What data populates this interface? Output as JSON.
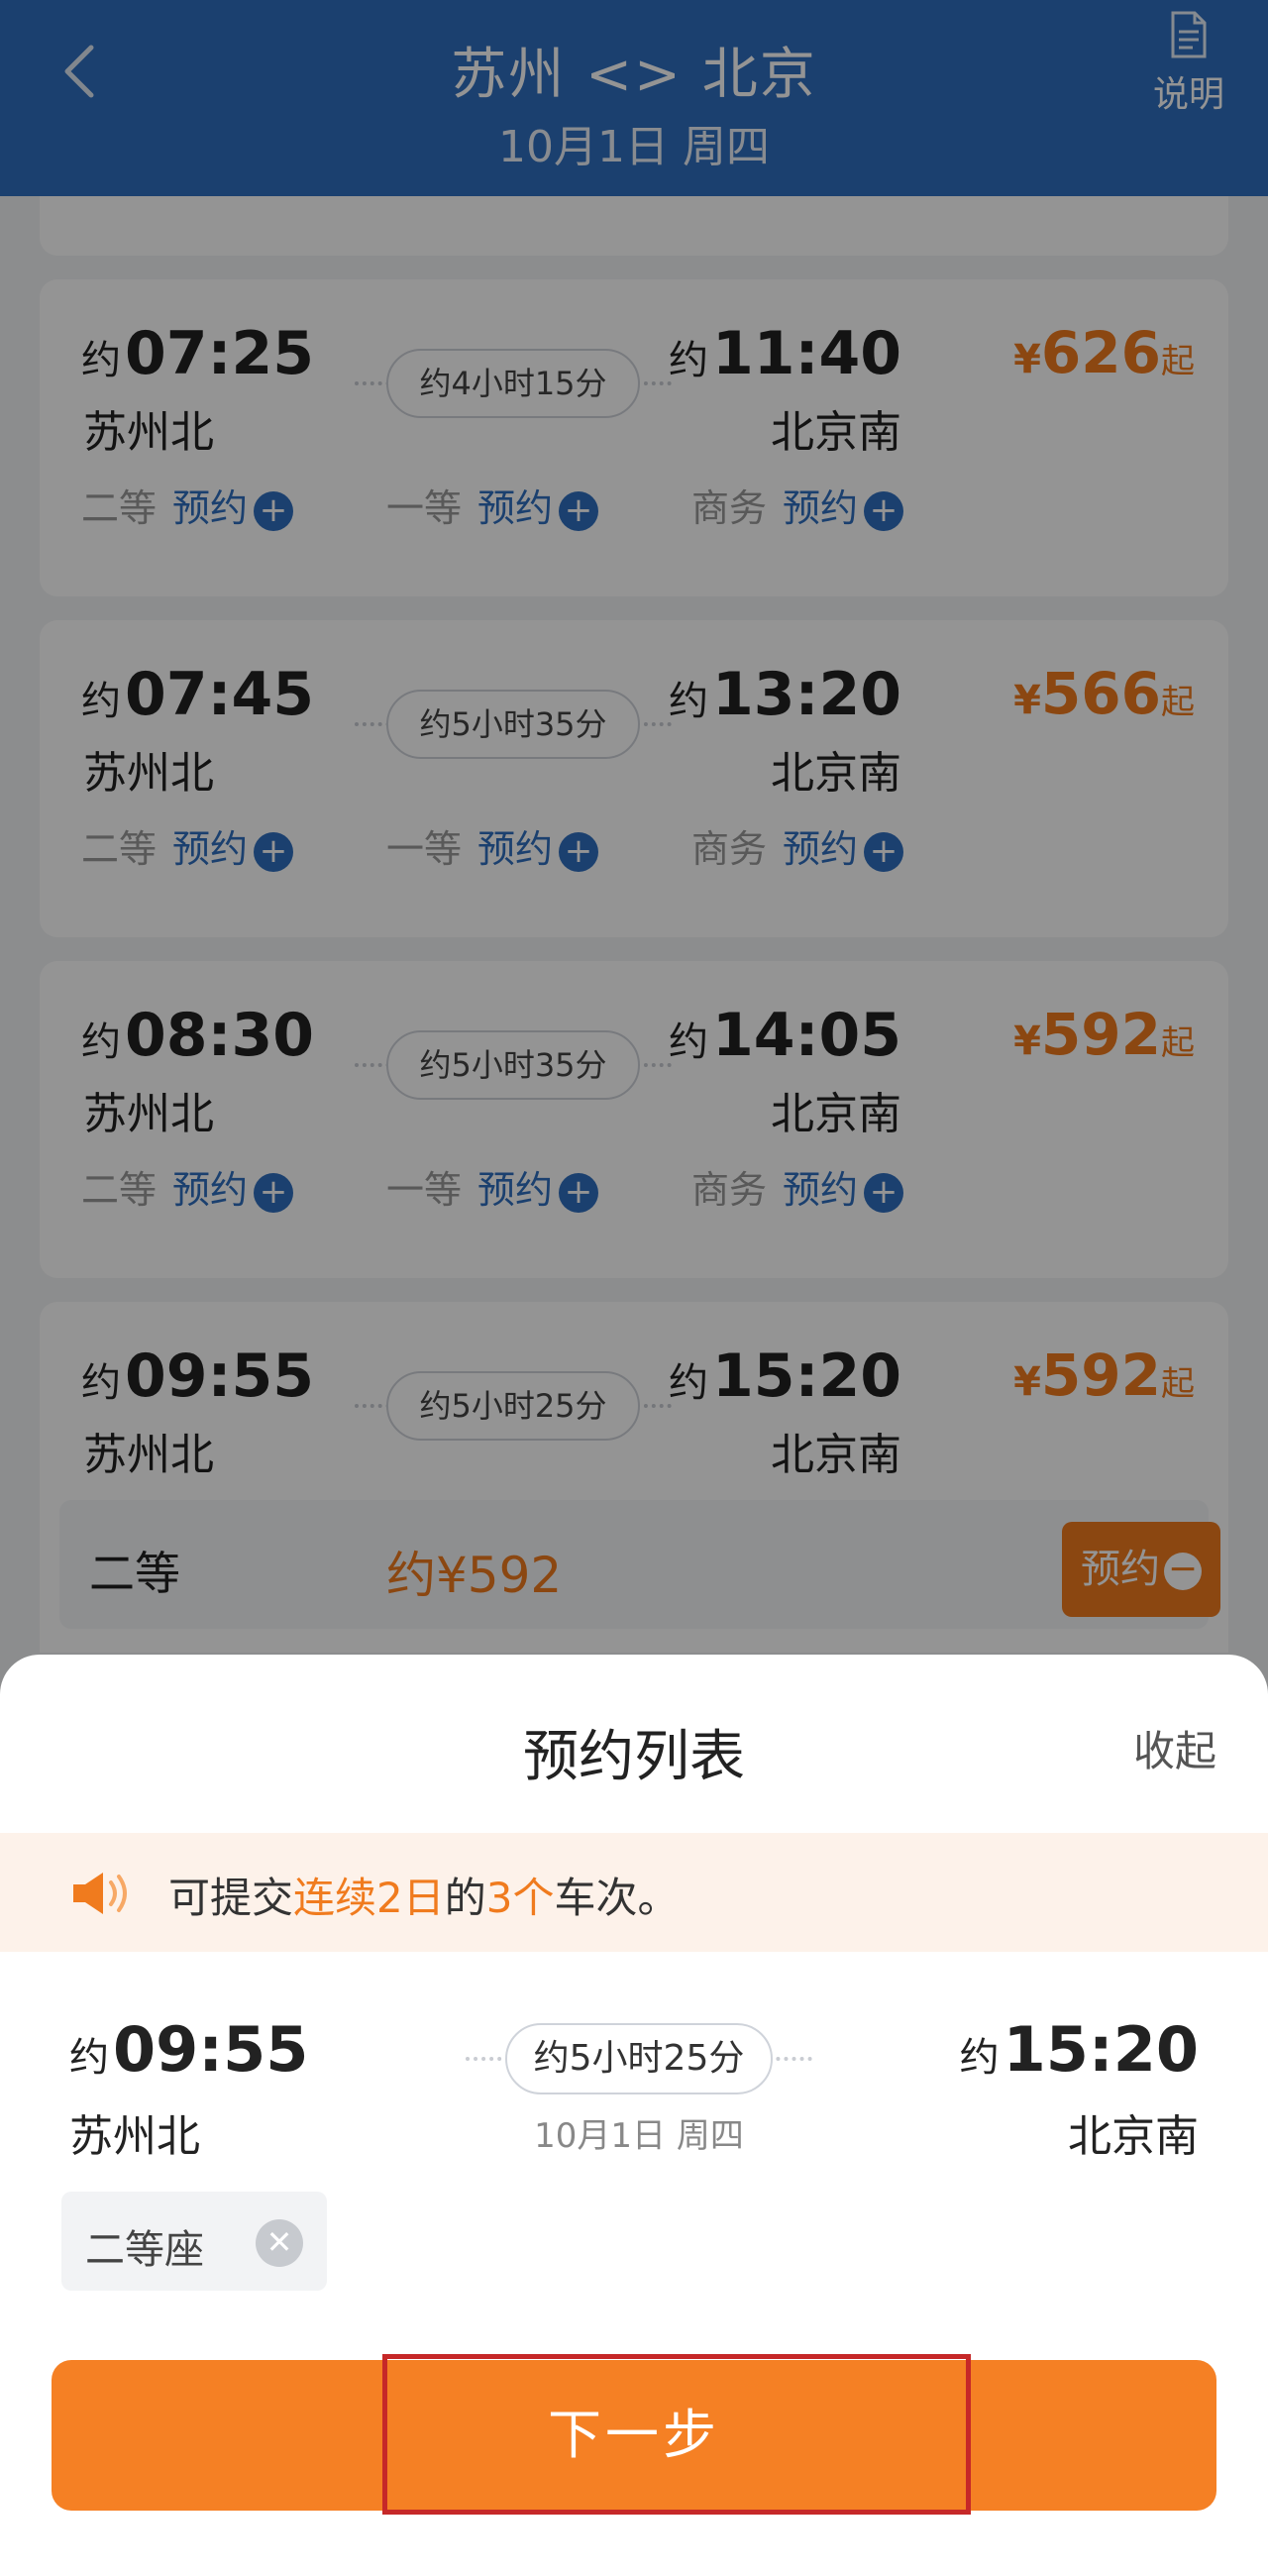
{
  "header": {
    "back_icon": "chevron-left-icon",
    "title": "苏州 <> 北京",
    "subtitle": "10月1日 周四",
    "help_icon": "document-icon",
    "help_label": "说明"
  },
  "trains": [
    {
      "approx": "约",
      "dep_time": "07:25",
      "dep_station": "苏州北",
      "duration": "约4小时15分",
      "arr_time": "11:40",
      "arr_station": "北京南",
      "price_currency": "¥",
      "price_value": "626",
      "price_suffix": "起",
      "seats": [
        {
          "name": "二等",
          "action": "预约"
        },
        {
          "name": "一等",
          "action": "预约"
        },
        {
          "name": "商务",
          "action": "预约"
        }
      ]
    },
    {
      "approx": "约",
      "dep_time": "07:45",
      "dep_station": "苏州北",
      "duration": "约5小时35分",
      "arr_time": "13:20",
      "arr_station": "北京南",
      "price_currency": "¥",
      "price_value": "566",
      "price_suffix": "起",
      "seats": [
        {
          "name": "二等",
          "action": "预约"
        },
        {
          "name": "一等",
          "action": "预约"
        },
        {
          "name": "商务",
          "action": "预约"
        }
      ]
    },
    {
      "approx": "约",
      "dep_time": "08:30",
      "dep_station": "苏州北",
      "duration": "约5小时35分",
      "arr_time": "14:05",
      "arr_station": "北京南",
      "price_currency": "¥",
      "price_value": "592",
      "price_suffix": "起",
      "seats": [
        {
          "name": "二等",
          "action": "预约"
        },
        {
          "name": "一等",
          "action": "预约"
        },
        {
          "name": "商务",
          "action": "预约"
        }
      ]
    },
    {
      "approx": "约",
      "dep_time": "09:55",
      "dep_station": "苏州北",
      "duration": "约5小时25分",
      "arr_time": "15:20",
      "arr_station": "北京南",
      "price_currency": "¥",
      "price_value": "592",
      "price_suffix": "起",
      "expanded": {
        "seat_name": "二等",
        "price": "约¥592",
        "button_label": "预约"
      }
    }
  ],
  "sheet": {
    "title": "预约列表",
    "collapse_label": "收起",
    "notice": {
      "icon": "speaker-icon",
      "prefix": "可提交",
      "highlight1": "连续2日",
      "mid": "的",
      "highlight2": "3个",
      "suffix": "车次。"
    },
    "selected": {
      "approx": "约",
      "dep_time": "09:55",
      "dep_station": "苏州北",
      "duration": "约5小时25分",
      "date": "10月1日 周四",
      "arr_time": "15:20",
      "arr_station": "北京南",
      "seat_label": "二等座"
    },
    "next_label": "下一步"
  },
  "colors": {
    "header_blue": "#2f6fbf",
    "accent_orange": "#f58024",
    "price_orange": "#f07b1e",
    "highlight_red": "#c62828"
  }
}
